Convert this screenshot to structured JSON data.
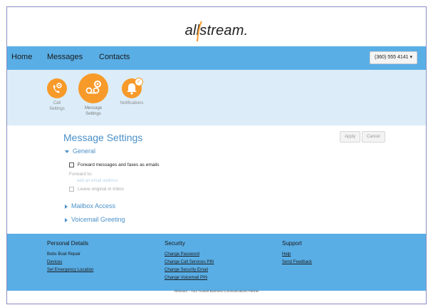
{
  "brand": {
    "name": "allstream."
  },
  "nav": {
    "home": "Home",
    "messages": "Messages",
    "contacts": "Contacts",
    "phone": "(360) 555 4141 ▾"
  },
  "subnav": {
    "items": [
      {
        "label_line1": "Call",
        "label_line2": "Settings",
        "icon": "phone-gear-icon"
      },
      {
        "label_line1": "Message",
        "label_line2": "Settings",
        "icon": "voicemail-gear-icon"
      },
      {
        "label_line1": "Notifications",
        "label_line2": "",
        "icon": "bell-icon"
      }
    ],
    "badge_icon": "check-icon"
  },
  "main": {
    "title": "Message Settings",
    "apply": "Apply",
    "cancel": "Cancel",
    "general": "General",
    "forward_option": "Forward messages and faxes as emails",
    "forward_to": "Forward to:",
    "email_placeholder": "add an email address",
    "leave_original": "Leave original in Inbox",
    "mailbox_access": "Mailbox Access",
    "voicemail_greeting": "Voicemail Greeting"
  },
  "footer": {
    "personal": {
      "title": "Personal Details",
      "business": "Bobs Boat Repair",
      "devices": "Devices",
      "emergency": "Set Emergency Location"
    },
    "security": {
      "title": "Security",
      "password": "Change Password",
      "pin": "Change Call Services PIN",
      "email": "Change Security Email",
      "voicemail_pin": "Change Voicemail PIN"
    },
    "support": {
      "title": "Support",
      "help": "Help",
      "feedback": "Send Feedback"
    },
    "tagline": "Allstream – Your Trusted Business Communications Partner"
  },
  "colors": {
    "nav": "#5aaee6",
    "accent": "#f79a2a",
    "subnav_bg": "#dcedf9",
    "title": "#4a90c8"
  }
}
